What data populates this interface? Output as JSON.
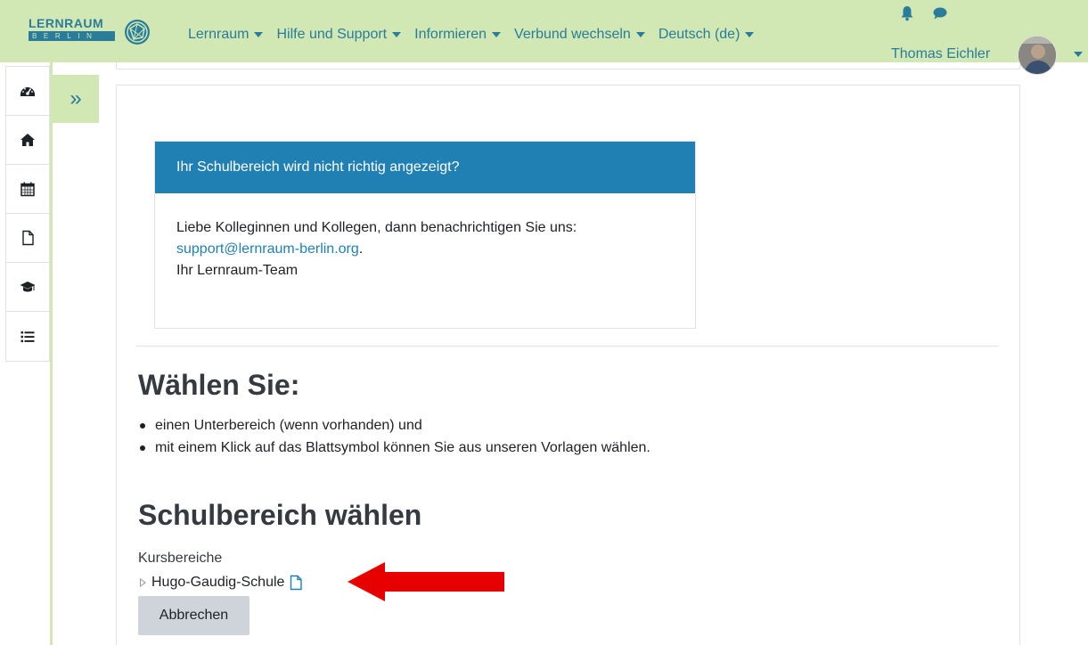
{
  "brand": {
    "name": "LERNRAUM",
    "sub": "BERLIN",
    "color": "#2a7d9a",
    "navbar_color": "#d1e7b4"
  },
  "nav": {
    "items": [
      {
        "label": "Lernraum"
      },
      {
        "label": "Hilfe und Support"
      },
      {
        "label": "Informieren"
      },
      {
        "label": "Verbund wechseln"
      },
      {
        "label": "Deutsch (de)"
      }
    ],
    "notification_icon": "bell-icon",
    "messages_icon": "comment-icon"
  },
  "user": {
    "name": "Thomas Eichler",
    "avatar": "user-photo"
  },
  "sidebar": {
    "icons": [
      "dashboard-icon",
      "home-icon",
      "calendar-icon",
      "file-icon",
      "graduation-cap-icon",
      "list-icon"
    ],
    "toggle_label": "»"
  },
  "notice": {
    "title": "Ihr Schulbereich wird nicht richtig angezeigt?",
    "line1": "Liebe Kolleginnen und Kollegen, dann benachrichtigen Sie uns:",
    "email": "support@lernraum-berlin.org",
    "email_suffix": ".",
    "signature": "Ihr Lernraum-Team",
    "header_color": "#2180b3"
  },
  "main": {
    "choose_heading": "Wählen Sie:",
    "bullets": [
      "einen Unterbereich (wenn vorhanden) und",
      "mit einem Klick auf das Blattsymbol können Sie aus unseren Vorlagen wählen."
    ],
    "select_heading": "Schulbereich wählen",
    "categories_label": "Kursbereiche",
    "category_item": "Hugo-Gaudig-Schule",
    "cancel_label": "Abbrechen",
    "annotation_arrow_color": "#e60000"
  }
}
